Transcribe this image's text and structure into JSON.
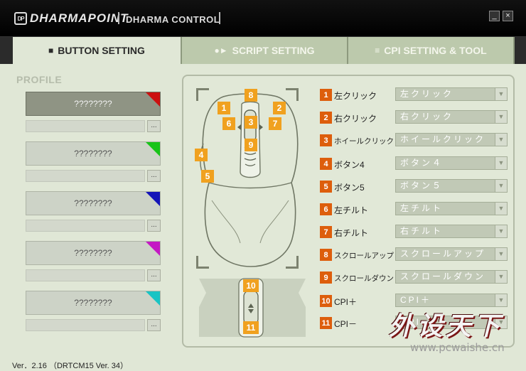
{
  "window": {
    "brand": "DHARMAPOINT",
    "brand_mark": "DP",
    "app_title": "DHARMA CONTROL",
    "minimize": "_",
    "close": "×"
  },
  "tabs": [
    {
      "icon": "■",
      "label": "BUTTON SETTING",
      "active": true
    },
    {
      "icon": "●►",
      "label": "SCRIPT SETTING",
      "active": false
    },
    {
      "icon": "≡",
      "label": "CPI SETTING & TOOL",
      "active": false
    }
  ],
  "profile": {
    "title": "PROFILE",
    "more_label": "...",
    "items": [
      {
        "name": "????????",
        "color": "#cc1010",
        "selected": true
      },
      {
        "name": "????????",
        "color": "#18c418",
        "selected": false
      },
      {
        "name": "????????",
        "color": "#1414b8",
        "selected": false
      },
      {
        "name": "????????",
        "color": "#c418c4",
        "selected": false
      },
      {
        "name": "????????",
        "color": "#18c4c4",
        "selected": false
      }
    ]
  },
  "mouse_tags": {
    "t1": "1",
    "t2": "2",
    "t3": "3",
    "t4": "4",
    "t5": "5",
    "t6": "6",
    "t7": "7",
    "t8": "8",
    "t9": "9",
    "t10": "10",
    "t11": "11"
  },
  "buttons": [
    {
      "num": "1",
      "label": "左クリック",
      "value": "左クリック"
    },
    {
      "num": "2",
      "label": "右クリック",
      "value": "右クリック"
    },
    {
      "num": "3",
      "label": "ホイールクリック",
      "value": "ホイールクリック"
    },
    {
      "num": "4",
      "label": "ボタン4",
      "value": "ボタン４"
    },
    {
      "num": "5",
      "label": "ボタン5",
      "value": "ボタン５"
    },
    {
      "num": "6",
      "label": "左チルト",
      "value": "左チルト"
    },
    {
      "num": "7",
      "label": "右チルト",
      "value": "右チルト"
    },
    {
      "num": "8",
      "label": "スクロールアップ",
      "value": "スクロールアップ"
    },
    {
      "num": "9",
      "label": "スクロールダウン",
      "value": "スクロールダウン"
    },
    {
      "num": "10",
      "label": "CPI＋",
      "value": "CPI＋"
    },
    {
      "num": "11",
      "label": "CPI－",
      "value": "CPI－"
    }
  ],
  "dropdown_icon": "▼",
  "status": {
    "version": "Ver．2.16 （DRTCM15 Ver. 34）"
  },
  "watermark": {
    "main": "外设天下",
    "url": "www.pcwaishe.cn"
  },
  "colors": {
    "accent_orange": "#f0a11f",
    "number_badge": "#dd5e0c",
    "panel_bg": "#e0e7d6"
  }
}
